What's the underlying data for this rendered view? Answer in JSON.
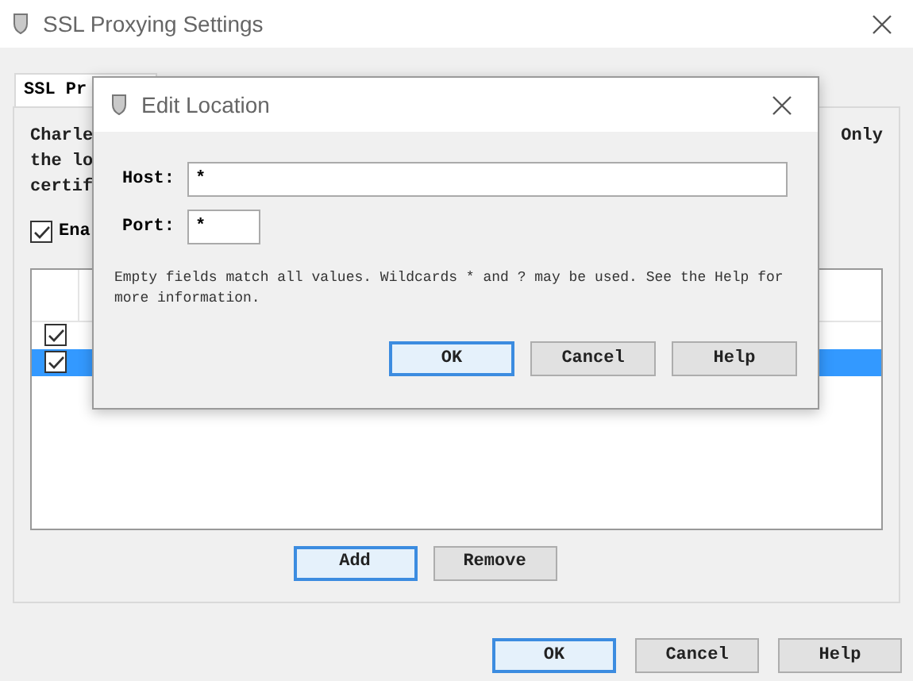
{
  "window": {
    "title": "SSL Proxying Settings"
  },
  "tabs": [
    {
      "label": "SSL Pr",
      "selected": true
    }
  ],
  "description": {
    "left_lines": [
      "Charle",
      "the lo",
      "certif"
    ],
    "right_text": "Only"
  },
  "enable_checkbox": {
    "label": "Ena",
    "checked": true
  },
  "table": {
    "rows": [
      {
        "checked": true,
        "selected": false
      },
      {
        "checked": true,
        "selected": true
      }
    ]
  },
  "table_buttons": [
    {
      "label": "Add",
      "default": true
    },
    {
      "label": "Remove",
      "default": false
    }
  ],
  "footer_buttons": [
    {
      "label": "OK",
      "default": true
    },
    {
      "label": "Cancel",
      "default": false
    },
    {
      "label": "Help",
      "default": false
    }
  ],
  "dialog": {
    "title": "Edit Location",
    "fields": [
      {
        "label": "Host:",
        "value": "*",
        "kind": "wide"
      },
      {
        "label": "Port:",
        "value": "*",
        "kind": "short"
      }
    ],
    "note": "Empty fields match all values. Wildcards * and ? may be used. See the Help for more information.",
    "buttons": [
      {
        "label": "OK",
        "default": true
      },
      {
        "label": "Cancel",
        "default": false
      },
      {
        "label": "Help",
        "default": false
      }
    ]
  }
}
